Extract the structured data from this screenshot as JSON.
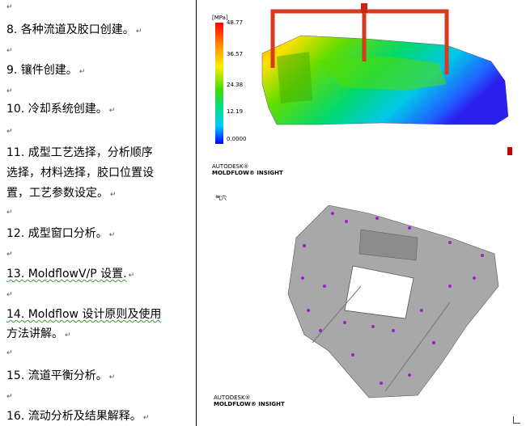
{
  "doc": {
    "items": [
      {
        "text": "8.  各种流道及胶口创建。"
      },
      {
        "text": "9.  镶件创建。"
      },
      {
        "text": "10. 冷却系统创建。"
      },
      {
        "text": "11. 成型工艺选择，分析顺序"
      },
      {
        "text": "选择，材料选择，胶口位置设"
      },
      {
        "text": "置，工艺参数设定。"
      },
      {
        "text": "12. 成型窗口分析。"
      },
      {
        "text": "13. MoldflowV/P 设置."
      },
      {
        "text": "14. Moldflow  设计原则及使用"
      },
      {
        "text": "方法讲解。"
      },
      {
        "text": "15. 流道平衡分析。"
      },
      {
        "text": "16. 流动分析及结果解释。"
      }
    ],
    "paragraph_mark": "↵",
    "empty_mark": "↵"
  },
  "figure1": {
    "unit": "[MPa]",
    "ticks": [
      "48.77",
      "36.57",
      "24.38",
      "12.19",
      "0.0000"
    ],
    "brand_line1": "AUTODESK®",
    "brand_line2": "MOLDFLOW® INSIGHT",
    "colors": {
      "hot": "#ff0000",
      "mid": "#44dd00",
      "cold": "#0000ff",
      "runner": "#d83a1e"
    }
  },
  "figure2": {
    "label": "气穴",
    "brand_line1": "AUTODESK®",
    "brand_line2": "MOLDFLOW® INSIGHT",
    "colors": {
      "part": "#9a9a9a",
      "markers": "#a020c0"
    }
  }
}
